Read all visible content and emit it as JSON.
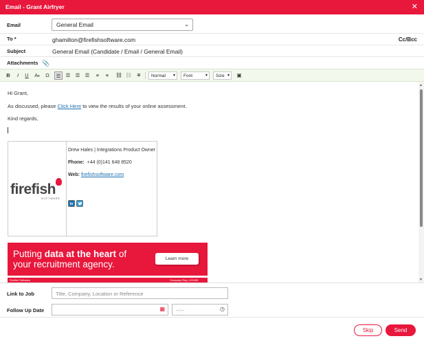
{
  "window": {
    "title": "Email - Grant Airfryer",
    "close_glyph": "✕"
  },
  "form": {
    "email_label": "Email",
    "email_select": "General Email",
    "to_label": "To *",
    "to_value": "ghamilton@firefishsoftware.com",
    "ccbcc_label": "Cc/Bcc",
    "subject_label": "Subject",
    "subject_value": "General Email (Candidate / Email / General Email)",
    "attachments_label": "Attachments"
  },
  "toolbar": {
    "bold": "B",
    "italic": "I",
    "underline": "U",
    "text_color": "A",
    "special_char": "Ω",
    "style_select": "Normal",
    "font_select": "Font",
    "size_select": "Size"
  },
  "body": {
    "greeting": "Hi Grant,",
    "line1_before": "As discussed, please ",
    "line1_link": "Click Here",
    "line1_after": " to view the results of your online assessment.",
    "closing": "Kind regards,",
    "signature": {
      "name_title": "Drew Hales | Integrations Product Owner",
      "phone_label": "Phone:",
      "phone_value": "+44 (0)141 648 8520",
      "web_label": "Web:",
      "web_value": "firefishsoftware.com",
      "logo_word": "firefish",
      "logo_sub": "SOFTWARE",
      "linkedin": "in"
    },
    "banner": {
      "line1_pre": "Putting ",
      "line1_bold": "data at the heart",
      "line1_post": " of",
      "line2": "your recruitment agency.",
      "cta": "Learn more",
      "footer_left": "Firefish Software",
      "footer_right": "Company Reg: 123456"
    }
  },
  "bottom": {
    "link_to_job_label": "Link to Job",
    "link_to_job_placeholder": "Title, Company, Location or Reference",
    "follow_up_label": "Follow Up Date",
    "time_placeholder": "--:--"
  },
  "actions": {
    "skip": "Skip",
    "send": "Send"
  },
  "colors": {
    "brand": "#e8173c",
    "link": "#1a6fb0",
    "toolbar_bg": "#f3f8ec"
  }
}
